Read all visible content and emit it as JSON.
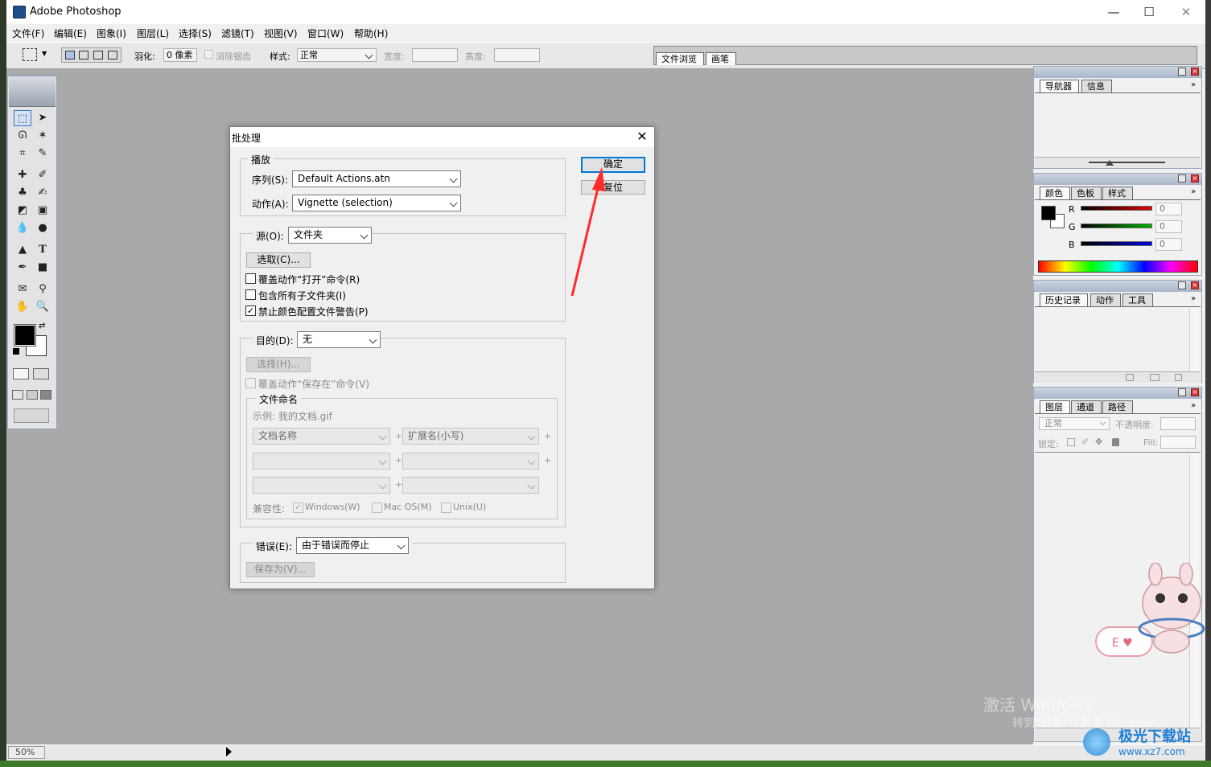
{
  "app": {
    "title": "Adobe Photoshop",
    "win_minimize": "—",
    "win_maximize": "☐",
    "win_close": "✕"
  },
  "menu": [
    "文件(F)",
    "编辑(E)",
    "图象(I)",
    "图层(L)",
    "选择(S)",
    "滤镜(T)",
    "视图(V)",
    "窗口(W)",
    "帮助(H)"
  ],
  "options": {
    "feather_label": "羽化:",
    "feather_value": "0 像素",
    "antialias_label": "消除锯齿",
    "style_label": "样式:",
    "style_value": "正常",
    "width_label": "宽度:",
    "height_label": "高度:",
    "tabs": [
      "文件浏览",
      "画笔"
    ]
  },
  "status": {
    "zoom": "50%"
  },
  "panels": {
    "navigator": {
      "tabs": [
        "导航器",
        "信息"
      ]
    },
    "color": {
      "tabs": [
        "颜色",
        "色板",
        "样式"
      ],
      "channels": [
        {
          "label": "R",
          "value": "0",
          "color": "#e00000"
        },
        {
          "label": "G",
          "value": "0",
          "color": "#00b000"
        },
        {
          "label": "B",
          "value": "0",
          "color": "#0000e0"
        }
      ]
    },
    "history": {
      "tabs": [
        "历史记录",
        "动作",
        "工具"
      ]
    },
    "layers": {
      "tabs": [
        "图层",
        "通道",
        "路径"
      ],
      "blend_mode": "正常",
      "opacity_label": "不透明度:",
      "lock_label": "锁定:",
      "fill_label": "Fill:"
    }
  },
  "dialog": {
    "title": "批处理",
    "close": "✕",
    "play_group": "播放",
    "set_label": "序列(S):",
    "set_value": "Default Actions.atn",
    "action_label": "动作(A):",
    "action_value": "Vignette (selection)",
    "source_label": "源(O):",
    "source_value": "文件夹",
    "choose_button": "选取(C)...",
    "override_open": "覆盖动作“打开”命令(R)",
    "include_subfolders": "包含所有子文件夹(I)",
    "suppress_color": "禁止颜色配置文件警告(P)",
    "suppress_check": "✓",
    "dest_label": "目的(D):",
    "dest_value": "无",
    "dest_choose_button": "选择(H)...",
    "override_save": "覆盖动作“保存在”命令(V)",
    "naming_group": "文件命名",
    "example": "示例: 我的文档.gif",
    "name_field1": "文档名称",
    "name_field2": "扩展名(小写)",
    "plus": "+",
    "compat_label": "兼容性:",
    "compat_windows": "Windows(W)",
    "compat_mac": "Mac OS(M)",
    "compat_unix": "Unix(U)",
    "errors_label": "错误(E):",
    "errors_value": "由于错误而停止",
    "save_as_button": "保存为(V)...",
    "ok_button": "确定",
    "reset_button": "复位"
  },
  "overlay": {
    "activate_line1": "激活 Windows",
    "activate_line2": "转到“设置”以激活 Windows。",
    "logo_text": "极光下载站",
    "logo_url": "www.xz7.com"
  },
  "colors": {
    "accent": "#0078d7",
    "annotation_arrow": "#ff2a2a",
    "canvas_gray": "#a9a9a9"
  }
}
